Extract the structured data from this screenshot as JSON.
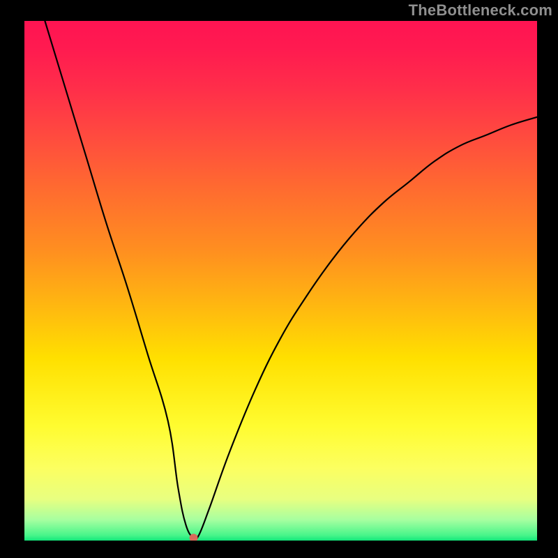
{
  "watermark_text": "TheBottleneck.com",
  "chart_data": {
    "type": "line",
    "title": "",
    "xlabel": "",
    "ylabel": "",
    "xlim": [
      0,
      100
    ],
    "ylim": [
      0,
      100
    ],
    "grid": false,
    "legend": false,
    "series": [
      {
        "name": "curve",
        "x": [
          4,
          8,
          12,
          16,
          20,
          24,
          28,
          30,
          31.5,
          33,
          34,
          36,
          40,
          45,
          50,
          55,
          60,
          65,
          70,
          75,
          80,
          85,
          90,
          95,
          100
        ],
        "y": [
          100,
          87,
          74,
          61,
          49,
          36,
          23,
          10,
          3,
          0.5,
          1,
          6,
          17,
          29,
          39,
          47,
          54,
          60,
          65,
          69,
          73,
          76,
          78,
          80,
          81.5
        ]
      }
    ],
    "marker": {
      "x": 33,
      "y": 0.5,
      "color": "#d96a5a",
      "radius_px": 6
    },
    "background_gradient": {
      "direction": "vertical",
      "stops": [
        {
          "pos": 0.0,
          "color": "#ff1452"
        },
        {
          "pos": 0.22,
          "color": "#ff4a3f"
        },
        {
          "pos": 0.44,
          "color": "#ff8e20"
        },
        {
          "pos": 0.65,
          "color": "#ffe000"
        },
        {
          "pos": 0.86,
          "color": "#fcff60"
        },
        {
          "pos": 0.96,
          "color": "#a7ffa0"
        },
        {
          "pos": 1.0,
          "color": "#12e67a"
        }
      ]
    }
  }
}
